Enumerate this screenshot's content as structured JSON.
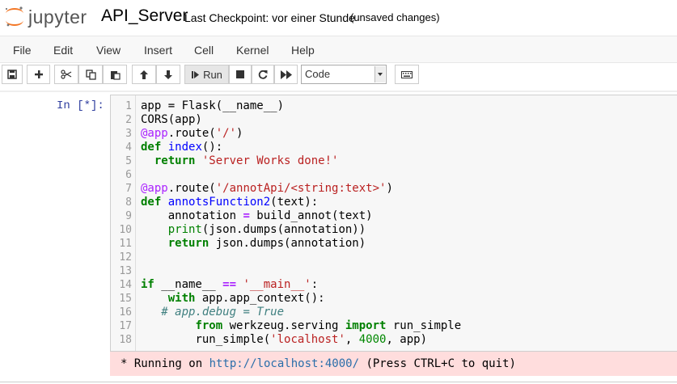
{
  "header": {
    "logo_text": "jupyter",
    "notebook_name": "API_Server",
    "checkpoint": "Last Checkpoint: vor einer Stunde",
    "autosave_status": "(unsaved changes)"
  },
  "menu": {
    "file": "File",
    "edit": "Edit",
    "view": "View",
    "insert": "Insert",
    "cell": "Cell",
    "kernel": "Kernel",
    "help": "Help"
  },
  "toolbar": {
    "run_label": "Run",
    "cell_type": "Code"
  },
  "cell": {
    "prompt": "In [*]:",
    "line_numbers": [
      "1",
      "2",
      "3",
      "4",
      "5",
      "6",
      "7",
      "8",
      "9",
      "10",
      "11",
      "12",
      "13",
      "14",
      "15",
      "16",
      "17",
      "18"
    ],
    "code": {
      "l1_a": "app = Flask(__name__)",
      "l2_a": "CORS(app)",
      "l3_dec": "@app",
      "l3_b": ".route(",
      "l3_str": "'/'",
      "l3_c": ")",
      "l4_kw": "def",
      "l4_fn": "index",
      "l4_c": "():",
      "l5_kw": "return",
      "l5_str": "'Server Works done!'",
      "l7_dec": "@app",
      "l7_b": ".route(",
      "l7_str": "'/annotApi/<string:text>'",
      "l7_c": ")",
      "l8_kw": "def",
      "l8_fn": "annotsFunction2",
      "l8_c": "(text):",
      "l9_a": "annotation ",
      "l9_op": "=",
      "l9_b": " build_annot(text)",
      "l10_bi": "print",
      "l10_b": "(json.dumps(annotation))",
      "l11_kw": "return",
      "l11_b": " json.dumps(annotation)",
      "l14_kw": "if",
      "l14_b": " __name__ ",
      "l14_op": "==",
      "l14_str": "'__main__'",
      "l14_c": ":",
      "l15_kw": "with",
      "l15_b": " app.app_context():",
      "l16_cmt": "# app.debug = True",
      "l17_kw1": "from",
      "l17_b": " werkzeug.serving ",
      "l17_kw2": "import",
      "l17_c": " run_simple",
      "l18_a": "run_simple(",
      "l18_str": "'localhost'",
      "l18_b": ", ",
      "l18_num": "4000",
      "l18_c": ", app)"
    }
  },
  "output": {
    "prefix": "* Running on ",
    "link": "http://localhost:4000/",
    "suffix": " (Press CTRL+C to quit)"
  },
  "colors": {
    "keyword": "#008000",
    "string": "#ba2121",
    "prompt": "#303f9f",
    "stderr_bg": "#ffdddd",
    "logo_orange": "#f37726"
  }
}
